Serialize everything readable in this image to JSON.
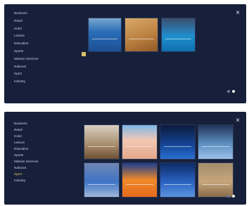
{
  "top_panel": {
    "menu_items": [
      "Business",
      "Retail",
      "Hotel",
      "Leisure",
      "Education",
      "Sports",
      "Mission Services",
      "National",
      "Sport",
      "Industry"
    ],
    "close_glyph": "×",
    "thumbnails": [
      {
        "name": "basketball-court-photo",
        "scene": "s-blue"
      },
      {
        "name": "wood-floor-photo",
        "scene": "s-wood"
      },
      {
        "name": "indoor-pool-photo",
        "scene": "s-pool"
      }
    ],
    "pager": {
      "pages": 2,
      "active": 1
    }
  },
  "bottom_panel": {
    "menu_items": [
      "Business",
      "Retail",
      "Hotel",
      "Leisure",
      "Education",
      "Sports",
      "Mission Services",
      "National",
      "Sport",
      "Industry"
    ],
    "selected_index": 8,
    "close_glyph": "×",
    "thumbnails": [
      {
        "name": "lounge-room-photo",
        "scene": "s-room"
      },
      {
        "name": "volleyball-court-photo",
        "scene": "s-peach"
      },
      {
        "name": "arena-floor-photo",
        "scene": "s-navy"
      },
      {
        "name": "sports-hall-photo",
        "scene": "s-hall"
      },
      {
        "name": "blue-court-photo",
        "scene": "s-court"
      },
      {
        "name": "orange-track-photo",
        "scene": "s-orange"
      },
      {
        "name": "blue-floor-photo",
        "scene": "s-floor"
      },
      {
        "name": "gymnasium-photo",
        "scene": "s-gym"
      }
    ],
    "pager": {
      "pages": 2,
      "active": 1
    }
  },
  "colors": {
    "panel_bg": "#16203a",
    "menu_text": "#c9d2e6",
    "selected_text": "#e6c25a",
    "handle": "#d9c26c"
  }
}
